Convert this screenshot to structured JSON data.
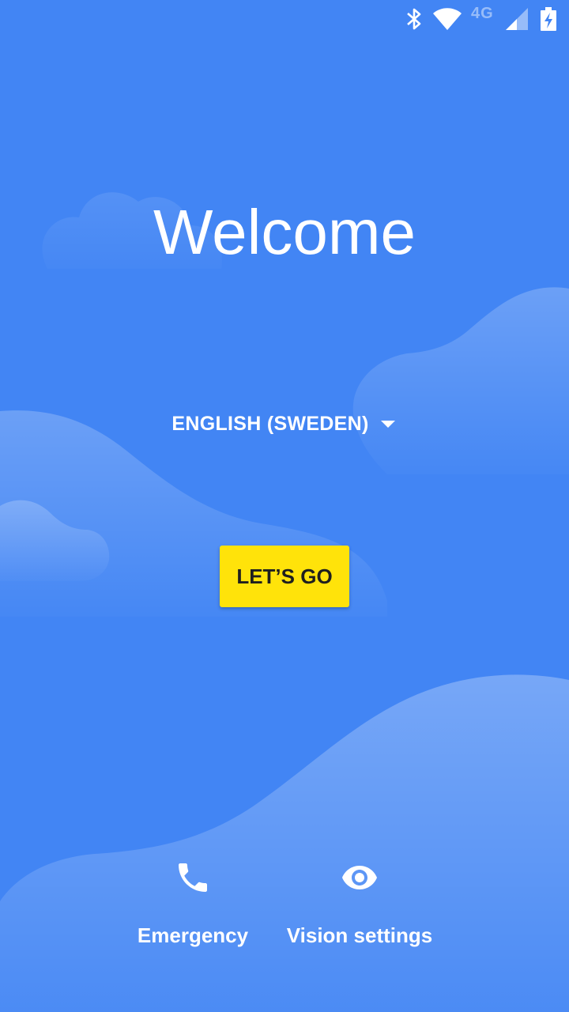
{
  "status_bar": {
    "network_type": "4G",
    "icons": [
      "bluetooth-icon",
      "wifi-icon",
      "cell-signal-icon",
      "battery-charging-icon"
    ]
  },
  "welcome": {
    "title": "Welcome",
    "language": "ENGLISH (SWEDEN)",
    "start_button": "LET’S GO"
  },
  "bottom_actions": {
    "emergency_label": "Emergency",
    "emergency_icon": "phone-icon",
    "vision_label": "Vision settings",
    "vision_icon": "eye-icon"
  },
  "colors": {
    "background": "#4285f4",
    "button": "#ffe30a",
    "button_text": "#1f1f1f",
    "text": "#ffffff"
  }
}
